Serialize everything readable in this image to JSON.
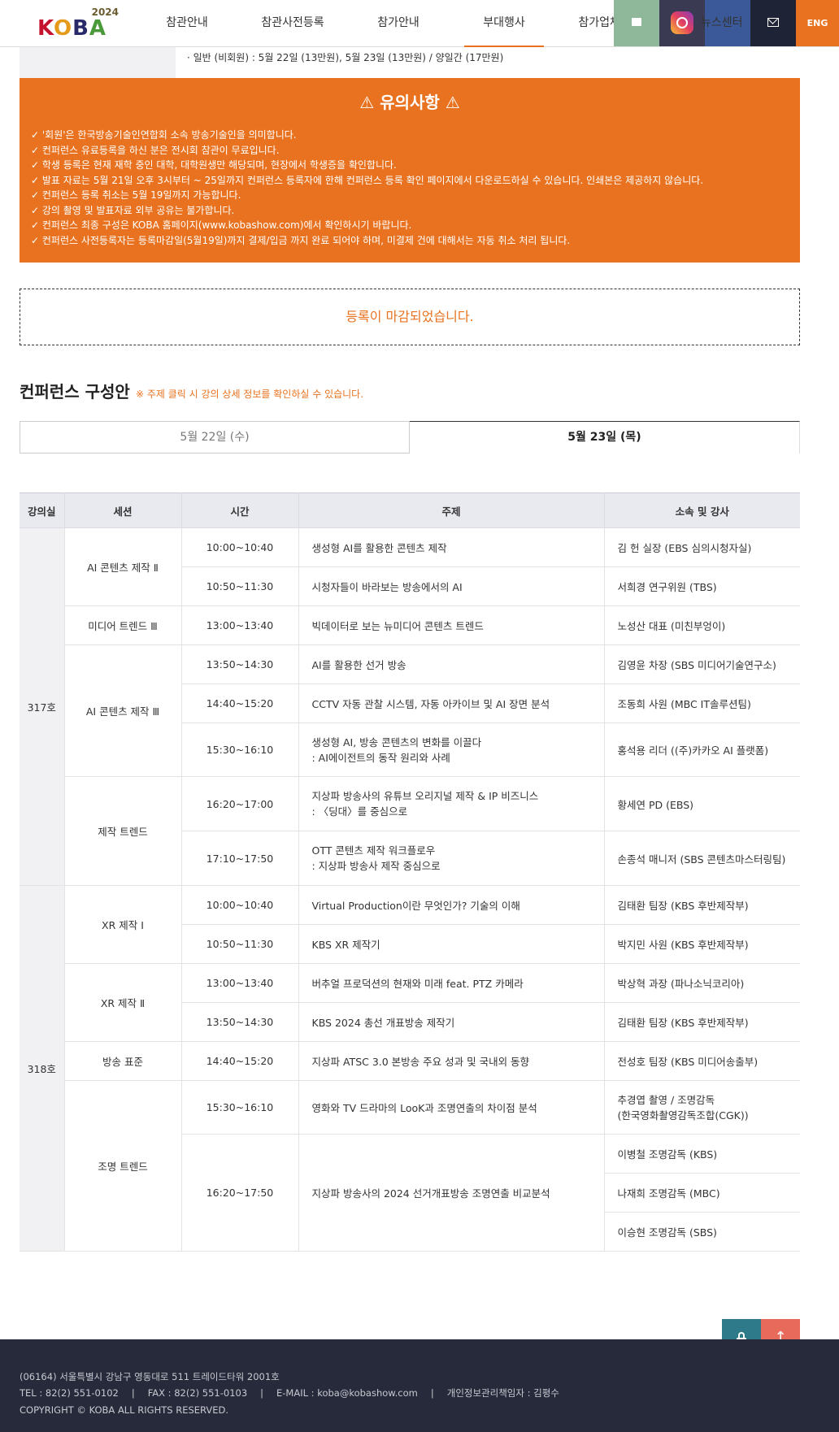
{
  "header": {
    "logo_text": "KOBA",
    "logo_year": "2024",
    "nav": [
      "참관안내",
      "참관사전등록",
      "참가안내",
      "부대행사",
      "참가업체검색"
    ],
    "nav_overlay": "뉴스센터",
    "eng_label": "ENG"
  },
  "info_strip": {
    "text": "· 일반 (비회원) : 5월 22일 (13만원), 5월 23일 (13만원) / 양일간 (17만원)"
  },
  "notice": {
    "title": "⚠ 유의사항 ⚠",
    "items": [
      "'회원'은 한국방송기술인연합회 소속 방송기술인을 의미합니다.",
      "컨퍼런스 유료등록을 하신 분은 전시회 참관이 무료입니다.",
      "학생 등록은 현재 재학 중인 대학, 대학원생만 해당되며, 현장에서 학생증을 확인합니다.",
      "발표 자료는 5월 21일 오후 3시부터 ~ 25일까지 컨퍼런스 등록자에 한해 컨퍼런스 등록 확인 페이지에서 다운로드하실 수 있습니다. 인쇄본은 제공하지 않습니다.",
      "컨퍼런스 등록 취소는 5월 19일까지 가능합니다.",
      "강의 촬영 및 발표자료 외부 공유는 불가합니다.",
      "컨퍼런스 최종 구성은 KOBA 홈페이지(www.kobashow.com)에서 확인하시기 바랍니다.",
      "컨퍼런스 사전등록자는 등록마감일(5월19일)까지 결제/입금 까지 완료 되어야 하며, 미결제 건에 대해서는 자동 취소 처리 됩니다."
    ]
  },
  "closed_message": "등록이 마감되었습니다.",
  "conference": {
    "title": "컨퍼런스 구성안",
    "note": "※ 주제 클릭 시 강의 상세 정보를 확인하실 수 있습니다.",
    "tabs": [
      "5월 22일 (수)",
      "5월 23일 (목)"
    ],
    "selected_tab": "5월 23일 (목)"
  },
  "table": {
    "headers": [
      "강의실",
      "세션",
      "시간",
      "주제",
      "소속 및 강사"
    ],
    "rooms": [
      "317호",
      "318호"
    ],
    "sessions": [
      "AI 콘텐츠 제작 Ⅱ",
      "미디어 트렌드 Ⅲ",
      "AI 콘텐츠 제작 Ⅲ",
      "제작 트렌드",
      "XR 제작 Ⅰ",
      "XR 제작 Ⅱ",
      "방송 표준",
      "조명 트렌드"
    ],
    "rows": [
      {
        "time": "10:00~10:40",
        "topic": "생성형 AI를 활용한 콘텐츠 제작",
        "topic2": "",
        "speaker": "김 헌 실장 (EBS 심의시청자실)"
      },
      {
        "time": "10:50~11:30",
        "topic": "시청자들이 바라보는 방송에서의 AI",
        "topic2": "",
        "speaker": "서희경 연구위원 (TBS)"
      },
      {
        "time": "13:00~13:40",
        "topic": "빅데이터로 보는 뉴미디어 콘텐츠 트렌드",
        "topic2": "",
        "speaker": "노성산 대표 (미친부엉이)"
      },
      {
        "time": "13:50~14:30",
        "topic": "AI를 활용한 선거 방송",
        "topic2": "",
        "speaker": "김영윤 차장 (SBS 미디어기술연구소)"
      },
      {
        "time": "14:40~15:20",
        "topic": "CCTV 자동 관찰 시스템, 자동 아카이브 및 AI 장면 분석",
        "topic2": "",
        "speaker": "조동희 사원 (MBC IT솔루션팀)"
      },
      {
        "time": "15:30~16:10",
        "topic": "생성형 AI, 방송 콘텐츠의 변화를 이끌다",
        "topic2": ": AI에이전트의 동작 원리와 사례",
        "speaker": "홍석용 리더 ((주)카카오 AI 플랫폼)"
      },
      {
        "time": "16:20~17:00",
        "topic": "지상파 방송사의 유튜브 오리지널 제작 & IP 비즈니스",
        "topic2": ": 〈딩대〉를 중심으로",
        "speaker": "황세연 PD (EBS)"
      },
      {
        "time": "17:10~17:50",
        "topic": "OTT 콘텐츠 제작 워크플로우",
        "topic2": ": 지상파 방송사 제작 중심으로",
        "speaker": "손종석 매니저 (SBS 콘텐츠마스터링팀)"
      },
      {
        "time": "10:00~10:40",
        "topic": "Virtual Production이란 무엇인가? 기술의 이해",
        "topic2": "",
        "speaker": "김태환 팀장 (KBS 후반제작부)"
      },
      {
        "time": "10:50~11:30",
        "topic": "KBS XR 제작기",
        "topic2": "",
        "speaker": "박지민 사원 (KBS 후반제작부)"
      },
      {
        "time": "13:00~13:40",
        "topic": "버추얼 프로덕션의 현재와 미래 feat. PTZ 카메라",
        "topic2": "",
        "speaker": "박상혁 과장 (파나소닉코리아)"
      },
      {
        "time": "13:50~14:30",
        "topic": "KBS 2024 총선 개표방송 제작기",
        "topic2": "",
        "speaker": "김태환 팀장 (KBS 후반제작부)"
      },
      {
        "time": "14:40~15:20",
        "topic": "지상파 ATSC 3.0 본방송 주요 성과 및 국내외 동향",
        "topic2": "",
        "speaker": "전성호 팀장 (KBS 미디어송출부)"
      },
      {
        "time": "15:30~16:10",
        "topic": "영화와 TV 드라마의 LooK과 조명연출의 차이점 분석",
        "topic2": "",
        "speaker": "추경엽 촬영 / 조명감독",
        "speaker2": "(한국영화촬영감독조합(CGK))"
      },
      {
        "time": "16:20~17:50",
        "topic": "지상파 방송사의 2024 선거개표방송 조명연출 비교분석",
        "topic2": "",
        "speaker": "이병철 조명감독 (KBS)"
      }
    ],
    "extra_speakers": [
      "나재희 조명감독 (MBC)",
      "이승현 조명감독 (SBS)"
    ]
  },
  "footer": {
    "address": "(06164) 서울특별시 강남구 영동대로 511 트레이드타워 2001호",
    "tel": "TEL : 82(2) 551-0102",
    "fax": "FAX : 82(2) 551-0103",
    "email": "E-MAIL : koba@kobashow.com",
    "privacy": "개인정보관리책임자 : 김평수",
    "copyright": "COPYRIGHT © KOBA ALL RIGHTS RESERVED.",
    "separator": "|"
  },
  "float": {
    "top_arrow": "↑"
  },
  "colors": {
    "accent": "#e8721f",
    "footer_bg": "#262a3b",
    "lock_btn": "#2f7a8a",
    "top_btn": "#e86a5a"
  }
}
